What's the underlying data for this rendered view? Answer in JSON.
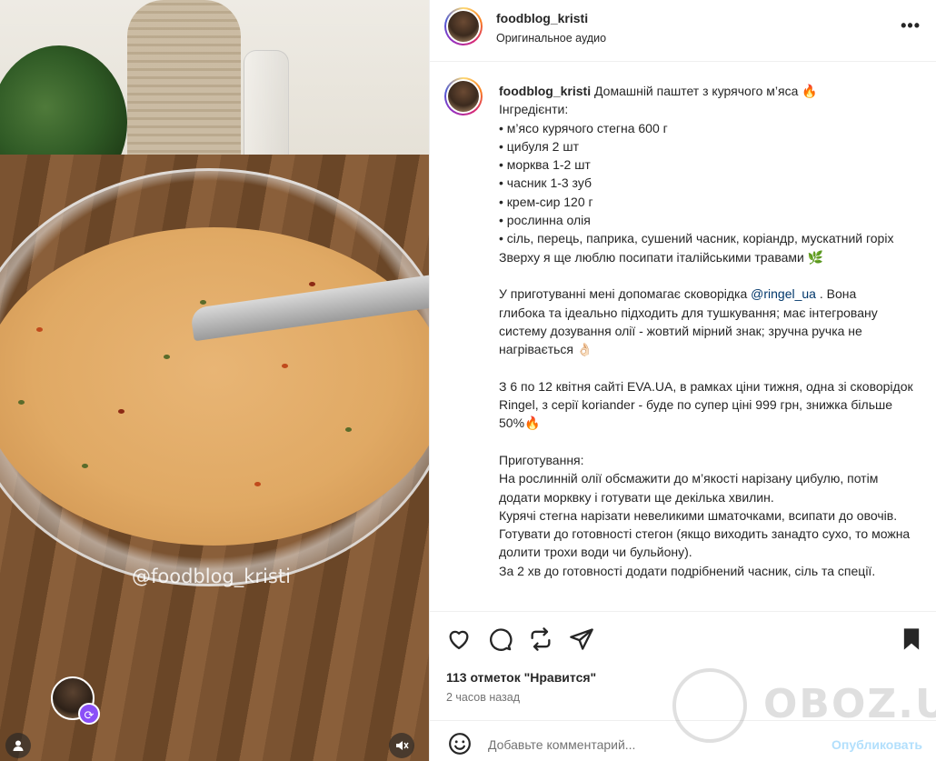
{
  "media": {
    "watermark": "@foodblog_kristi"
  },
  "header": {
    "username": "foodblog_kristi",
    "audio": "Оригинальное аудио",
    "more_label": "•••"
  },
  "caption": {
    "username": "foodblog_kristi",
    "lines": [
      "Домашній паштет з курячого м’яса 🔥",
      "Інгредієнти:",
      "• м’ясо курячого стегна 600 г",
      "• цибуля 2 шт",
      "• морква 1-2 шт",
      "• часник 1-3 зуб",
      "• крем-сир 120 г",
      "• рослинна олія",
      "• сіль, перець, паприка, сушений часник, коріандр, мускатний горіх",
      "Зверху я ще люблю посипати італійськими травами 🌿",
      "",
      "У приготуванні мені допомагає сковорідка",
      "глибока та ідеально підходить для тушкування; має інтегровану систему дозування олії - жовтий мірний знак; зручна ручка не нагрівається 👌🏻",
      "",
      "З 6 по 12 квітня сайті EVA.UA, в рамках ціни тижня, одна зі сковорідок Ringel, з серії koriander - буде по супер ціні 999 грн, знижка більше 50%🔥",
      "",
      "Приготування:",
      "На рослинній олії обсмажити до м’якості нарізану цибулю, потім додати морквку і готувати ще декілька хвилин.",
      "Курячі стегна нарізати невеликими шматочками, всипати до овочів. Готувати до готовності стегон (якщо виходить занадто сухо, то можна долити трохи води чи бульйону).",
      "За 2 хв до готовності додати подрібнений часник, сіль та спеції."
    ],
    "mention": "@ringel_ua",
    "mention_suffix": ". Вона"
  },
  "actions": {
    "likes": "113 отметок \"Нравится\"",
    "time": "2 часов назад"
  },
  "comment": {
    "placeholder": "Добавьте комментарий...",
    "post_label": "Опубликовать"
  },
  "site_watermark": "OBOZ.UA",
  "colors": {
    "link": "#00376b",
    "post_disabled": "#b2dffc",
    "muted": "#737373"
  }
}
